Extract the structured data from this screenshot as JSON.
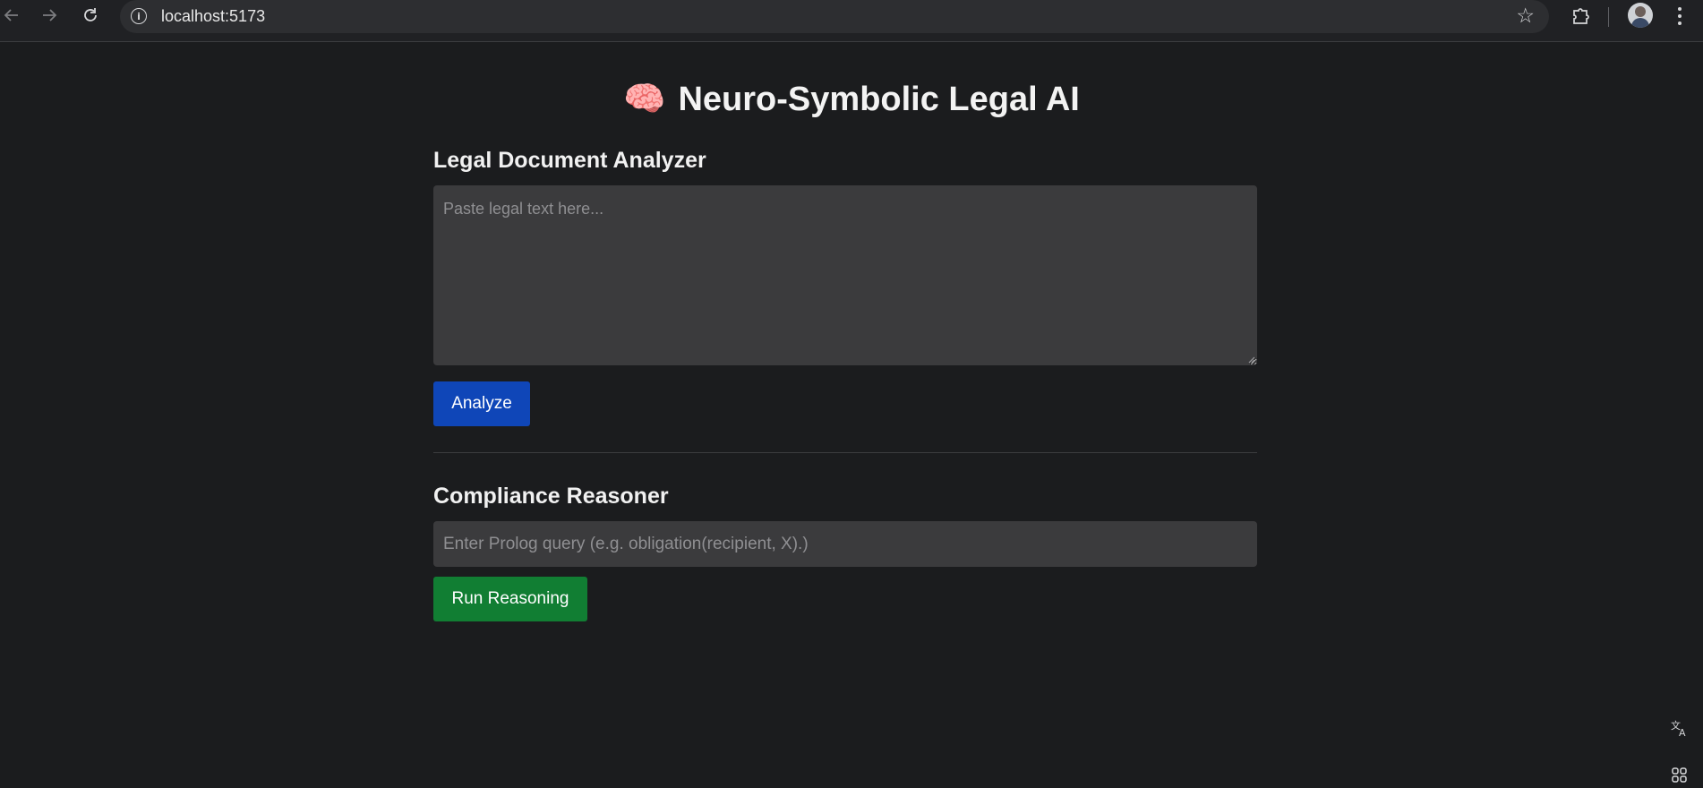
{
  "browser": {
    "url": "localhost:5173",
    "icons": {
      "back": "back-arrow-icon",
      "forward": "forward-arrow-icon",
      "reload": "reload-icon",
      "info": "site-info-icon",
      "bookmark": "bookmark-star-icon",
      "extensions": "extensions-puzzle-icon",
      "profile": "profile-avatar",
      "menu": "kebab-menu-icon"
    }
  },
  "header": {
    "emoji": "🧠",
    "title": "Neuro-Symbolic Legal AI"
  },
  "analyzer": {
    "heading": "Legal Document Analyzer",
    "textarea_placeholder": "Paste legal text here...",
    "textarea_value": "",
    "button_label": "Analyze",
    "button_color": "#0f46b8"
  },
  "reasoner": {
    "heading": "Compliance Reasoner",
    "input_placeholder": "Enter Prolog query (e.g. obligation(recipient, X).)",
    "input_value": "",
    "button_label": "Run Reasoning",
    "button_color": "#117e33"
  },
  "side_tools": {
    "icons": [
      "translate-icon",
      "apps-grid-icon"
    ]
  }
}
